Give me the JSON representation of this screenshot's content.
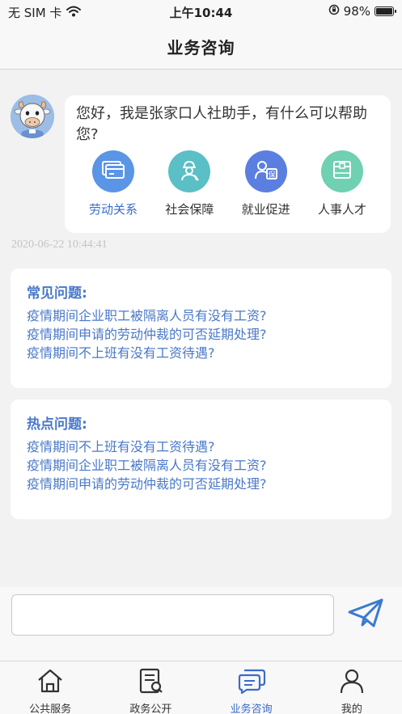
{
  "status_bar": {
    "carrier": "无 SIM 卡",
    "time": "上午10:44",
    "battery": "98%",
    "battery_level": 0.98,
    "icons": [
      "wifi-icon",
      "orientation-lock-icon",
      "battery-icon"
    ]
  },
  "nav": {
    "title": "业务咨询"
  },
  "chat": {
    "greeting": "您好，我是张家口人社助手，有什么可以帮助您?",
    "services": [
      {
        "label": "劳动关系",
        "icon": "card-icon",
        "color": "#5a95e6",
        "active": true
      },
      {
        "label": "社会保障",
        "icon": "worker-icon",
        "color": "#5bbfc6",
        "active": false
      },
      {
        "label": "就业促进",
        "icon": "insurance-person-icon",
        "color": "#5b7fe0",
        "active": false
      },
      {
        "label": "人事人才",
        "icon": "folder-icon",
        "color": "#6fd0b2",
        "active": false
      }
    ],
    "timestamp": "2020-06-22 10:44:41"
  },
  "faq_common": {
    "title": "常见问题:",
    "items": [
      "疫情期间企业职工被隔离人员有没有工资?",
      "疫情期间申请的劳动仲裁的可否延期处理?",
      "疫情期间不上班有没有工资待遇?"
    ]
  },
  "faq_hot": {
    "title": "热点问题:",
    "items": [
      "疫情期间不上班有没有工资待遇?",
      "疫情期间企业职工被隔离人员有没有工资?",
      "疫情期间申请的劳动仲裁的可否延期处理?"
    ]
  },
  "input": {
    "value": "",
    "placeholder": ""
  },
  "tabs": [
    {
      "label": "公共服务",
      "icon": "home-icon",
      "active": false
    },
    {
      "label": "政务公开",
      "icon": "document-search-icon",
      "active": false
    },
    {
      "label": "业务咨询",
      "icon": "chat-icon",
      "active": true
    },
    {
      "label": "我的",
      "icon": "user-icon",
      "active": false
    }
  ],
  "colors": {
    "accent": "#3a6cc9",
    "link": "#4a78c8",
    "background": "#f2f2f2"
  }
}
